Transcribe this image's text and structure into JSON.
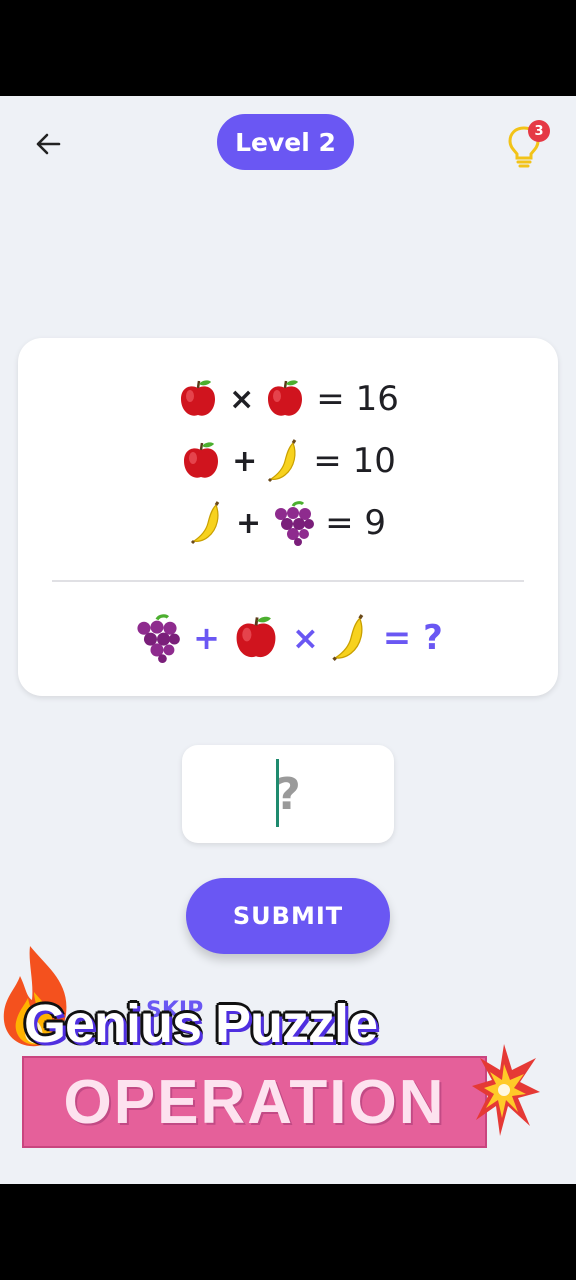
{
  "header": {
    "level_label": "Level 2",
    "hint_count": "3"
  },
  "puzzle": {
    "equations": [
      {
        "left": "apple",
        "op": "×",
        "right": "apple",
        "result": "= 16"
      },
      {
        "left": "apple",
        "op": "+",
        "right": "banana",
        "result": "= 10"
      },
      {
        "left": "banana",
        "op": "+",
        "right": "grapes",
        "result": "= 9"
      }
    ],
    "question": {
      "terms": [
        "grapes",
        "apple",
        "banana"
      ],
      "ops": [
        "+",
        "×"
      ],
      "result": "= ?"
    }
  },
  "answer": {
    "placeholder": "?",
    "value": ""
  },
  "submit_label": "SUBMIT",
  "skip_label": "SKIP",
  "overlay": {
    "title": "Genius Puzzle",
    "banner": "OPERATION"
  },
  "colors": {
    "accent": "#6a57f3",
    "background": "#eef1f6",
    "badge": "#e53945",
    "banner": "#e5609a"
  },
  "icons": {
    "back": "arrow-left-icon",
    "hint": "lightbulb-icon",
    "fruits": [
      "apple-icon",
      "banana-icon",
      "grapes-icon"
    ]
  }
}
